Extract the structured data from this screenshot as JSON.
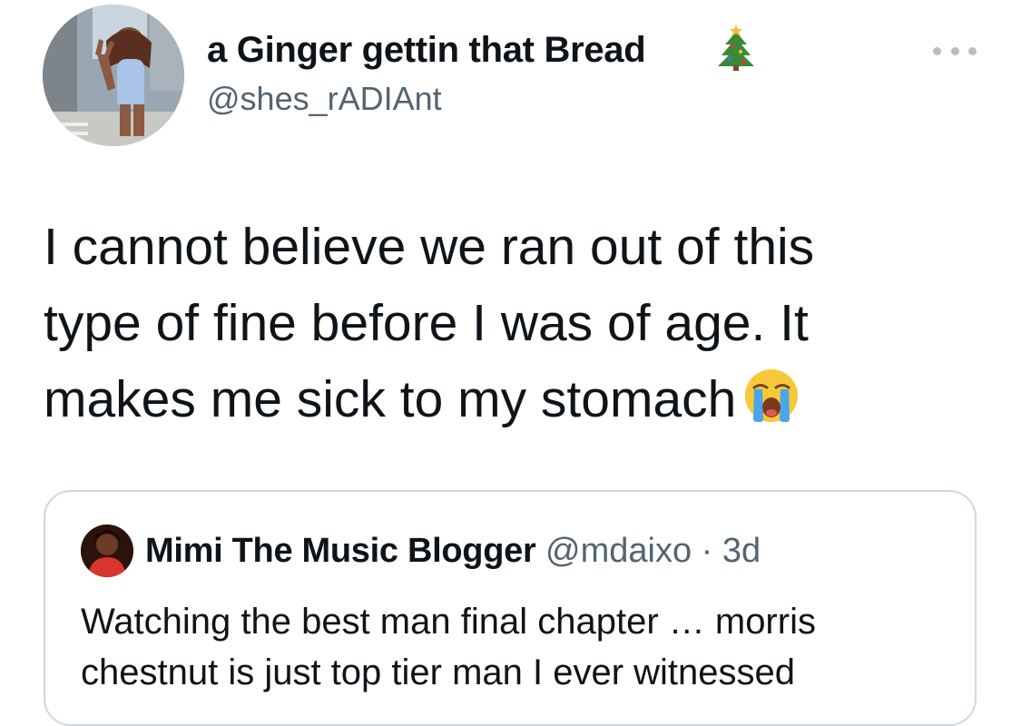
{
  "author": {
    "display_name": "a Ginger gettin that Bread",
    "handle": "@shes_rADIAnt",
    "name_emoji": "christmas-tree-icon"
  },
  "tweet": {
    "lines": [
      "I cannot believe we ran out of this",
      "type of fine before I was of age. It",
      "makes me sick to my stomach"
    ],
    "emoji": "loudly-crying-face-icon"
  },
  "quoted_tweet": {
    "display_name": "Mimi The Music Blogger",
    "handle": "@mdaixo",
    "separator": "·",
    "time": "3d",
    "lines": [
      "Watching the best man final chapter … morris",
      "chestnut is just top tier man I ever witnessed"
    ]
  },
  "colors": {
    "text_primary": "#0f1419",
    "text_secondary": "#536471",
    "border": "#cfd9de"
  }
}
